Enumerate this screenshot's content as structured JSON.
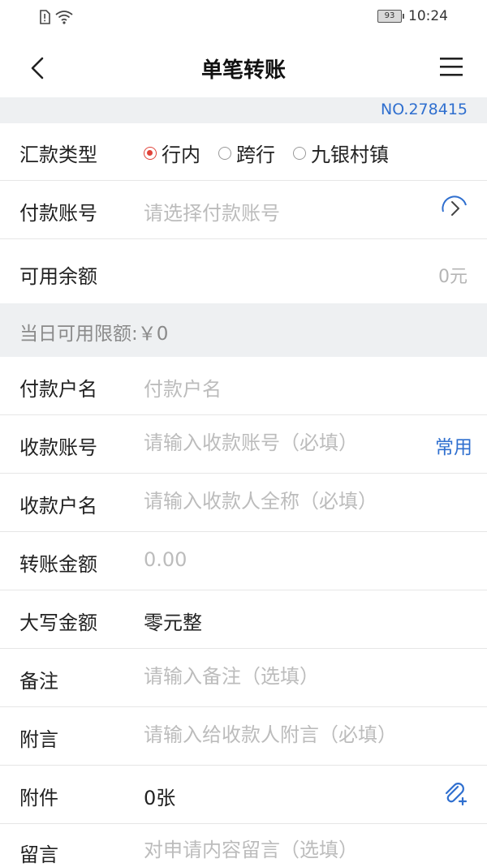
{
  "status_bar": {
    "battery": "93",
    "time": "10:24"
  },
  "header": {
    "title": "单笔转账"
  },
  "serial_no": "NO.278415",
  "remit_type": {
    "label": "汇款类型",
    "options": [
      "行内",
      "跨行",
      "九银村镇"
    ],
    "selected": "行内"
  },
  "pay_account": {
    "label": "付款账号",
    "placeholder": "请选择付款账号"
  },
  "available_balance": {
    "label": "可用余额",
    "value": "0元"
  },
  "daily_limit": {
    "text": "当日可用限额:￥0"
  },
  "payer_name": {
    "label": "付款户名",
    "placeholder": "付款户名"
  },
  "payee_account": {
    "label": "收款账号",
    "placeholder": "请输入收款账号（必填）",
    "link": "常用"
  },
  "payee_name": {
    "label": "收款户名",
    "placeholder": "请输入收款人全称（必填）"
  },
  "amount": {
    "label": "转账金额",
    "placeholder": "0.00"
  },
  "amount_upper": {
    "label": "大写金额",
    "value": "零元整"
  },
  "remark": {
    "label": "备注",
    "placeholder": "请输入备注（选填）"
  },
  "postscript": {
    "label": "附言",
    "placeholder": "请输入给收款人附言（必填）"
  },
  "attachment": {
    "label": "附件",
    "value": "0张"
  },
  "message": {
    "label": "留言",
    "placeholder": "对申请内容留言（选填）"
  },
  "colors": {
    "accent": "#2f6fcf",
    "radio_selected": "#e0443a",
    "band": "#eef0f2"
  }
}
